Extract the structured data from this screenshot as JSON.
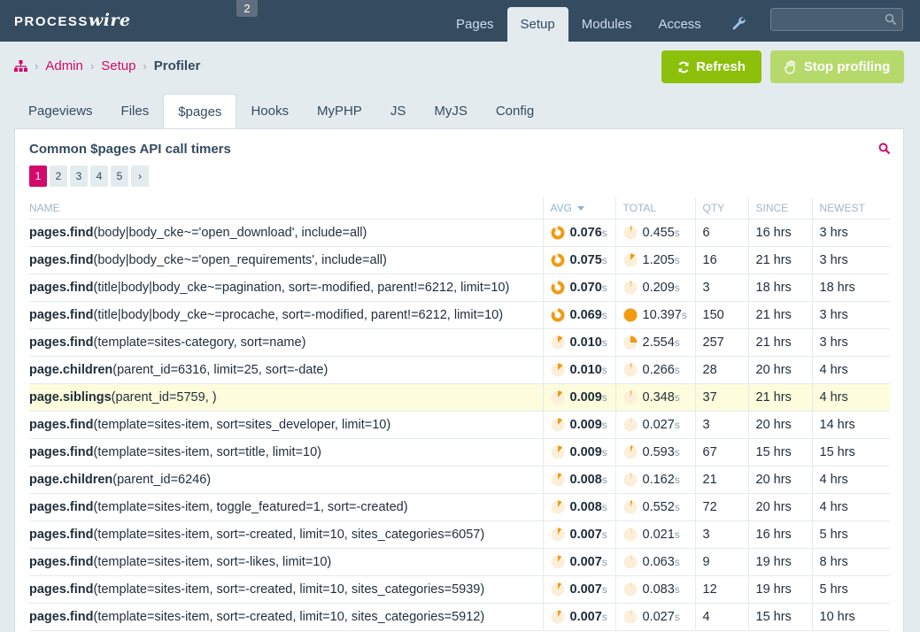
{
  "app": {
    "logo_main": "PROCESS",
    "logo_wire": "wire",
    "badge": "2"
  },
  "topnav": [
    {
      "label": "Pages",
      "active": false
    },
    {
      "label": "Setup",
      "active": true
    },
    {
      "label": "Modules",
      "active": false
    },
    {
      "label": "Access",
      "active": false
    }
  ],
  "search": {
    "placeholder": ""
  },
  "breadcrumb": {
    "home_icon": "sitemap-icon",
    "items": [
      "Admin",
      "Setup"
    ],
    "current": "Profiler"
  },
  "buttons": {
    "refresh": "Refresh",
    "stop": "Stop profiling"
  },
  "tabs": [
    "Pageviews",
    "Files",
    "$pages",
    "Hooks",
    "MyPHP",
    "JS",
    "MyJS",
    "Config"
  ],
  "active_tab": "$pages",
  "panel": {
    "title": "Common $pages API call timers"
  },
  "pagination": {
    "pages": [
      "1",
      "2",
      "3",
      "4",
      "5"
    ],
    "current": "1",
    "next": "›"
  },
  "table": {
    "columns": [
      "Name",
      "Avg",
      "Total",
      "Qty",
      "Since",
      "Newest"
    ],
    "sorted_column": "Avg",
    "unit": "s",
    "rows": [
      {
        "fn": "pages.find",
        "args": "(body|body_cke~='open_download', include=all)",
        "avg": "0.076",
        "avg_frac": 0.9,
        "total": "0.455",
        "total_frac": 0.04,
        "qty": "6",
        "since": "16 hrs",
        "newest": "3 hrs"
      },
      {
        "fn": "pages.find",
        "args": "(body|body_cke~='open_requirements', include=all)",
        "avg": "0.075",
        "avg_frac": 0.9,
        "total": "1.205",
        "total_frac": 0.12,
        "qty": "16",
        "since": "21 hrs",
        "newest": "3 hrs"
      },
      {
        "fn": "pages.find",
        "args": "(title|body|body_cke~=pagination, sort=-modified, parent!=6212, limit=10)",
        "avg": "0.070",
        "avg_frac": 0.85,
        "total": "0.209",
        "total_frac": 0.02,
        "qty": "3",
        "since": "18 hrs",
        "newest": "18 hrs"
      },
      {
        "fn": "pages.find",
        "args": "(title|body|body_cke~=procache, sort=-modified, parent!=6212, limit=10)",
        "avg": "0.069",
        "avg_frac": 0.84,
        "total": "10.397",
        "total_frac": 1.0,
        "qty": "150",
        "since": "21 hrs",
        "newest": "3 hrs"
      },
      {
        "fn": "pages.find",
        "args": "(template=sites-category, sort=name)",
        "avg": "0.010",
        "avg_frac": 0.13,
        "total": "2.554",
        "total_frac": 0.25,
        "qty": "257",
        "since": "21 hrs",
        "newest": "3 hrs"
      },
      {
        "fn": "page.children",
        "args": "(parent_id=6316, limit=25, sort=-date)",
        "avg": "0.010",
        "avg_frac": 0.13,
        "total": "0.266",
        "total_frac": 0.03,
        "qty": "28",
        "since": "20 hrs",
        "newest": "4 hrs"
      },
      {
        "fn": "page.siblings",
        "args": "(parent_id=5759, )",
        "avg": "0.009",
        "avg_frac": 0.12,
        "total": "0.348",
        "total_frac": 0.03,
        "qty": "37",
        "since": "21 hrs",
        "newest": "4 hrs",
        "highlight": true
      },
      {
        "fn": "pages.find",
        "args": "(template=sites-item, sort=sites_developer, limit=10)",
        "avg": "0.009",
        "avg_frac": 0.12,
        "total": "0.027",
        "total_frac": 0.005,
        "qty": "3",
        "since": "20 hrs",
        "newest": "14 hrs"
      },
      {
        "fn": "pages.find",
        "args": "(template=sites-item, sort=title, limit=10)",
        "avg": "0.009",
        "avg_frac": 0.12,
        "total": "0.593",
        "total_frac": 0.06,
        "qty": "67",
        "since": "15 hrs",
        "newest": "15 hrs"
      },
      {
        "fn": "page.children",
        "args": "(parent_id=6246)",
        "avg": "0.008",
        "avg_frac": 0.1,
        "total": "0.162",
        "total_frac": 0.016,
        "qty": "21",
        "since": "20 hrs",
        "newest": "4 hrs"
      },
      {
        "fn": "pages.find",
        "args": "(template=sites-item, toggle_featured=1, sort=-created)",
        "avg": "0.008",
        "avg_frac": 0.1,
        "total": "0.552",
        "total_frac": 0.05,
        "qty": "72",
        "since": "20 hrs",
        "newest": "4 hrs"
      },
      {
        "fn": "pages.find",
        "args": "(template=sites-item, sort=-created, limit=10, sites_categories=6057)",
        "avg": "0.007",
        "avg_frac": 0.09,
        "total": "0.021",
        "total_frac": 0.002,
        "qty": "3",
        "since": "16 hrs",
        "newest": "5 hrs"
      },
      {
        "fn": "pages.find",
        "args": "(template=sites-item, sort=-likes, limit=10)",
        "avg": "0.007",
        "avg_frac": 0.09,
        "total": "0.063",
        "total_frac": 0.006,
        "qty": "9",
        "since": "19 hrs",
        "newest": "8 hrs"
      },
      {
        "fn": "pages.find",
        "args": "(template=sites-item, sort=-created, limit=10, sites_categories=5939)",
        "avg": "0.007",
        "avg_frac": 0.09,
        "total": "0.083",
        "total_frac": 0.008,
        "qty": "12",
        "since": "19 hrs",
        "newest": "5 hrs"
      },
      {
        "fn": "pages.find",
        "args": "(template=sites-item, sort=-created, limit=10, sites_categories=5912)",
        "avg": "0.007",
        "avg_frac": 0.09,
        "total": "0.027",
        "total_frac": 0.003,
        "qty": "4",
        "since": "15 hrs",
        "newest": "10 hrs"
      }
    ]
  },
  "colors": {
    "accent": "#d30a6a",
    "header": "#354b60",
    "green": "#8cc00b",
    "green_light": "#b6d96c",
    "pie": "#f29a12",
    "pie_bg": "#fcefd9",
    "highlight": "#fdfcdc"
  }
}
